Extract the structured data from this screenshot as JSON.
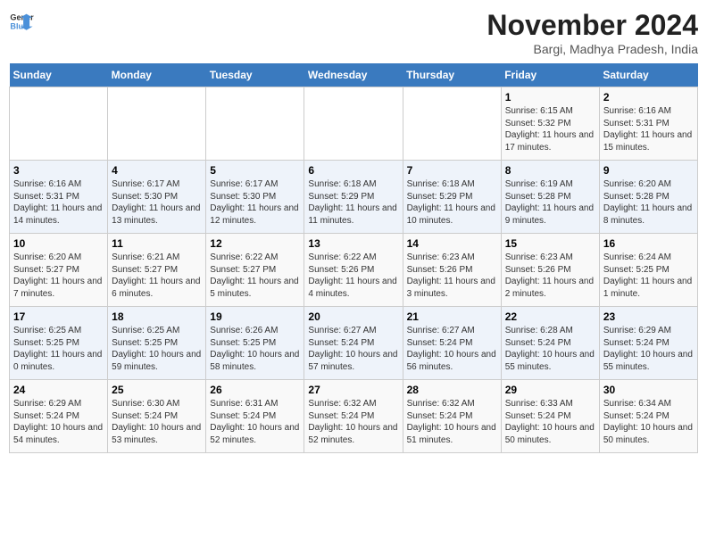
{
  "header": {
    "logo_line1": "General",
    "logo_line2": "Blue",
    "title": "November 2024",
    "location": "Bargi, Madhya Pradesh, India"
  },
  "weekdays": [
    "Sunday",
    "Monday",
    "Tuesday",
    "Wednesday",
    "Thursday",
    "Friday",
    "Saturday"
  ],
  "weeks": [
    [
      {
        "day": "",
        "info": ""
      },
      {
        "day": "",
        "info": ""
      },
      {
        "day": "",
        "info": ""
      },
      {
        "day": "",
        "info": ""
      },
      {
        "day": "",
        "info": ""
      },
      {
        "day": "1",
        "info": "Sunrise: 6:15 AM\nSunset: 5:32 PM\nDaylight: 11 hours and 17 minutes."
      },
      {
        "day": "2",
        "info": "Sunrise: 6:16 AM\nSunset: 5:31 PM\nDaylight: 11 hours and 15 minutes."
      }
    ],
    [
      {
        "day": "3",
        "info": "Sunrise: 6:16 AM\nSunset: 5:31 PM\nDaylight: 11 hours and 14 minutes."
      },
      {
        "day": "4",
        "info": "Sunrise: 6:17 AM\nSunset: 5:30 PM\nDaylight: 11 hours and 13 minutes."
      },
      {
        "day": "5",
        "info": "Sunrise: 6:17 AM\nSunset: 5:30 PM\nDaylight: 11 hours and 12 minutes."
      },
      {
        "day": "6",
        "info": "Sunrise: 6:18 AM\nSunset: 5:29 PM\nDaylight: 11 hours and 11 minutes."
      },
      {
        "day": "7",
        "info": "Sunrise: 6:18 AM\nSunset: 5:29 PM\nDaylight: 11 hours and 10 minutes."
      },
      {
        "day": "8",
        "info": "Sunrise: 6:19 AM\nSunset: 5:28 PM\nDaylight: 11 hours and 9 minutes."
      },
      {
        "day": "9",
        "info": "Sunrise: 6:20 AM\nSunset: 5:28 PM\nDaylight: 11 hours and 8 minutes."
      }
    ],
    [
      {
        "day": "10",
        "info": "Sunrise: 6:20 AM\nSunset: 5:27 PM\nDaylight: 11 hours and 7 minutes."
      },
      {
        "day": "11",
        "info": "Sunrise: 6:21 AM\nSunset: 5:27 PM\nDaylight: 11 hours and 6 minutes."
      },
      {
        "day": "12",
        "info": "Sunrise: 6:22 AM\nSunset: 5:27 PM\nDaylight: 11 hours and 5 minutes."
      },
      {
        "day": "13",
        "info": "Sunrise: 6:22 AM\nSunset: 5:26 PM\nDaylight: 11 hours and 4 minutes."
      },
      {
        "day": "14",
        "info": "Sunrise: 6:23 AM\nSunset: 5:26 PM\nDaylight: 11 hours and 3 minutes."
      },
      {
        "day": "15",
        "info": "Sunrise: 6:23 AM\nSunset: 5:26 PM\nDaylight: 11 hours and 2 minutes."
      },
      {
        "day": "16",
        "info": "Sunrise: 6:24 AM\nSunset: 5:25 PM\nDaylight: 11 hours and 1 minute."
      }
    ],
    [
      {
        "day": "17",
        "info": "Sunrise: 6:25 AM\nSunset: 5:25 PM\nDaylight: 11 hours and 0 minutes."
      },
      {
        "day": "18",
        "info": "Sunrise: 6:25 AM\nSunset: 5:25 PM\nDaylight: 10 hours and 59 minutes."
      },
      {
        "day": "19",
        "info": "Sunrise: 6:26 AM\nSunset: 5:25 PM\nDaylight: 10 hours and 58 minutes."
      },
      {
        "day": "20",
        "info": "Sunrise: 6:27 AM\nSunset: 5:24 PM\nDaylight: 10 hours and 57 minutes."
      },
      {
        "day": "21",
        "info": "Sunrise: 6:27 AM\nSunset: 5:24 PM\nDaylight: 10 hours and 56 minutes."
      },
      {
        "day": "22",
        "info": "Sunrise: 6:28 AM\nSunset: 5:24 PM\nDaylight: 10 hours and 55 minutes."
      },
      {
        "day": "23",
        "info": "Sunrise: 6:29 AM\nSunset: 5:24 PM\nDaylight: 10 hours and 55 minutes."
      }
    ],
    [
      {
        "day": "24",
        "info": "Sunrise: 6:29 AM\nSunset: 5:24 PM\nDaylight: 10 hours and 54 minutes."
      },
      {
        "day": "25",
        "info": "Sunrise: 6:30 AM\nSunset: 5:24 PM\nDaylight: 10 hours and 53 minutes."
      },
      {
        "day": "26",
        "info": "Sunrise: 6:31 AM\nSunset: 5:24 PM\nDaylight: 10 hours and 52 minutes."
      },
      {
        "day": "27",
        "info": "Sunrise: 6:32 AM\nSunset: 5:24 PM\nDaylight: 10 hours and 52 minutes."
      },
      {
        "day": "28",
        "info": "Sunrise: 6:32 AM\nSunset: 5:24 PM\nDaylight: 10 hours and 51 minutes."
      },
      {
        "day": "29",
        "info": "Sunrise: 6:33 AM\nSunset: 5:24 PM\nDaylight: 10 hours and 50 minutes."
      },
      {
        "day": "30",
        "info": "Sunrise: 6:34 AM\nSunset: 5:24 PM\nDaylight: 10 hours and 50 minutes."
      }
    ]
  ]
}
